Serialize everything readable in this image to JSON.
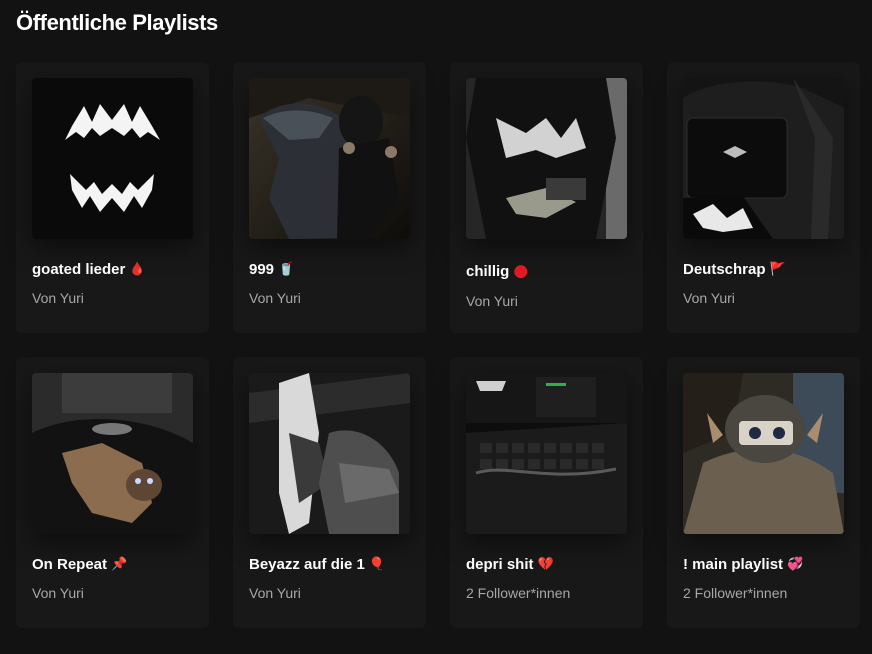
{
  "section": {
    "title": "Öffentliche Playlists"
  },
  "playlists": [
    {
      "title": "goated lieder",
      "emoji": "🩸",
      "emoji_color": "#e0202f",
      "subtitle": "Von Yuri",
      "cover_icon": "fangs-cover"
    },
    {
      "title": "999",
      "emoji": "🥤",
      "emoji_color": "#d62d2d",
      "subtitle": "Von Yuri",
      "cover_icon": "hooded-figure-cover"
    },
    {
      "title": "chillig",
      "emoji": "●",
      "emoji_color": "#e31b23",
      "subtitle": "Von Yuri",
      "cover_icon": "shirt-money-cover"
    },
    {
      "title": "Deutschrap",
      "emoji": "🚩",
      "emoji_color": "#e0202f",
      "subtitle": "Von Yuri",
      "cover_icon": "bag-cover"
    },
    {
      "title": "On Repeat",
      "emoji": "📌",
      "emoji_color": "#e0202f",
      "subtitle": "Von Yuri",
      "cover_icon": "cat-cover"
    },
    {
      "title": "Beyazz auf die 1",
      "emoji": "🎈",
      "emoji_color": "#e0202f",
      "subtitle": "Von Yuri",
      "cover_icon": "sneaker-cover"
    },
    {
      "title": "depri shit",
      "emoji": "💔",
      "emoji_color": "#e0202f",
      "subtitle": "2 Follower*innen",
      "cover_icon": "laptop-cover"
    },
    {
      "title": "! main playlist",
      "emoji": "💞",
      "emoji_color": "#e0202f",
      "subtitle": "2 Follower*innen",
      "cover_icon": "anime-mask-cover"
    }
  ]
}
